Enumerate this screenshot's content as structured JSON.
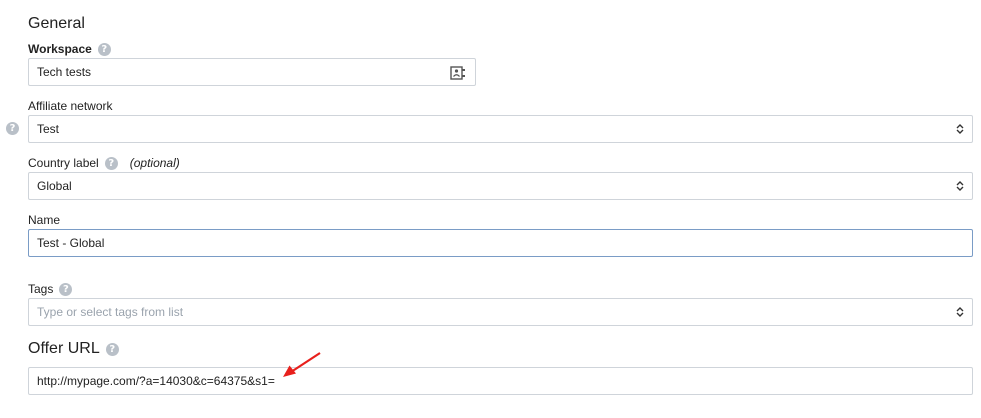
{
  "section_general": {
    "title": "General"
  },
  "workspace": {
    "label": "Workspace",
    "value": "Tech tests",
    "picker_icon": "contact-card-icon"
  },
  "affiliate_network": {
    "label": "Affiliate network",
    "value": "Test"
  },
  "country_label": {
    "label": "Country label",
    "optional_text": "(optional)",
    "value": "Global"
  },
  "name": {
    "label": "Name",
    "value": "Test - Global"
  },
  "tags": {
    "label": "Tags",
    "placeholder": "Type or select tags from list"
  },
  "offer_url": {
    "title": "Offer URL",
    "value": "http://mypage.com/?a=14030&c=64375&s1="
  },
  "help_glyph": "?",
  "colors": {
    "border": "#cfd4da",
    "focus_border": "#7a9cc6",
    "help_icon": "#b9c0c8",
    "arrow": "#e8201c"
  }
}
